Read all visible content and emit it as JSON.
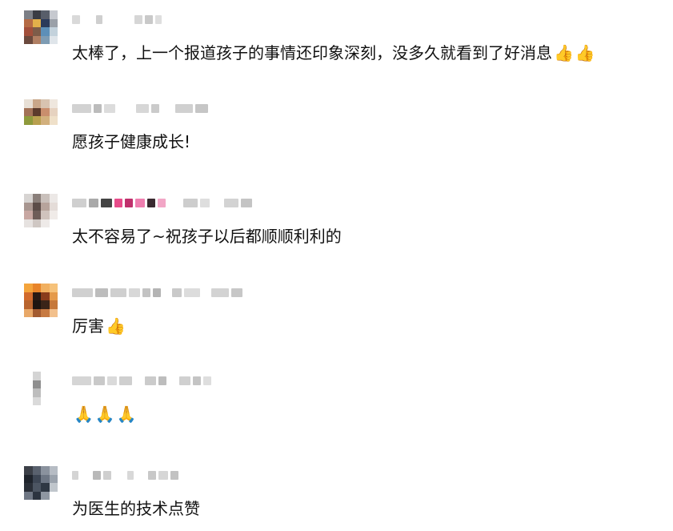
{
  "comments": [
    {
      "text": "太棒了，上一个报道孩子的事情还印象深刻，没多久就看到了好消息",
      "emojis": [
        "👍",
        "👍"
      ],
      "emoji_icon": "thumbs-up-icon",
      "avatar_colors": [
        "#7c7f86",
        "#3a3c44",
        "#585e6a",
        "#c6c9cf",
        "#b56b45",
        "#e3b04a",
        "#2b3a5a",
        "#9aa0a8",
        "#a24f3b",
        "#7d5c49",
        "#5d8fb8",
        "#c3d2dc",
        "#6b4a3e",
        "#b07f63",
        "#7e9cb4",
        "#dfe5ea"
      ]
    },
    {
      "text": "愿孩子健康成长!",
      "emojis": [],
      "avatar_colors": [
        "#e8e0d6",
        "#c9a78a",
        "#d8c3b0",
        "#efe7de",
        "#a27257",
        "#5c3b2c",
        "#c98e6d",
        "#e6d2c0",
        "#8e9a3c",
        "#b9a04f",
        "#d2b07d",
        "#efe0c9",
        "#ffffff",
        "#ffffff",
        "#ffffff",
        "#ffffff"
      ]
    },
    {
      "text": "太不容易了~祝孩子以后都顺顺利利的",
      "emojis": [],
      "avatar_colors": [
        "#d7d4d2",
        "#8a7f7a",
        "#c9c0bb",
        "#ece8e6",
        "#a89690",
        "#5b4c48",
        "#b7a49c",
        "#e4dcd8",
        "#c8a7a2",
        "#6f5c58",
        "#d0c3bd",
        "#f0ebe8",
        "#e6e2e0",
        "#cfc7c3",
        "#eeeae8",
        "#ffffff"
      ]
    },
    {
      "text": "厉害",
      "emojis": [
        "👍"
      ],
      "emoji_icon": "thumbs-up-outline-icon",
      "avatar_colors": [
        "#f4a43c",
        "#e8842a",
        "#f1b060",
        "#f6c27a",
        "#d26a2c",
        "#2a1a14",
        "#8a3c1c",
        "#e59a4a",
        "#b8642e",
        "#1d1410",
        "#3a2418",
        "#c6783a",
        "#e8a868",
        "#a35b30",
        "#c77a42",
        "#f2c08c"
      ]
    },
    {
      "text": "",
      "emojis": [
        "🙏",
        "🙏",
        "🙏"
      ],
      "emoji_icon": "folded-hands-icon",
      "avatar_colors": [
        "#ffffff",
        "#d4d4d4",
        "#ffffff",
        "#ffffff",
        "#ffffff",
        "#8f8f8f",
        "#ffffff",
        "#ffffff",
        "#ffffff",
        "#bdbdbd",
        "#ffffff",
        "#ffffff",
        "#ffffff",
        "#dadada",
        "#ffffff",
        "#ffffff"
      ]
    },
    {
      "text": "为医生的技术点赞",
      "emojis": [],
      "avatar_colors": [
        "#3c4048",
        "#59616e",
        "#8a929e",
        "#b6bcc4",
        "#1f242c",
        "#3d4654",
        "#6d7684",
        "#9aa2ac",
        "#2a2f38",
        "#4c5562",
        "#2f3844",
        "#c0c6cc",
        "#6f7784",
        "#2c3440",
        "#8f97a2",
        "#ffffff"
      ]
    }
  ]
}
